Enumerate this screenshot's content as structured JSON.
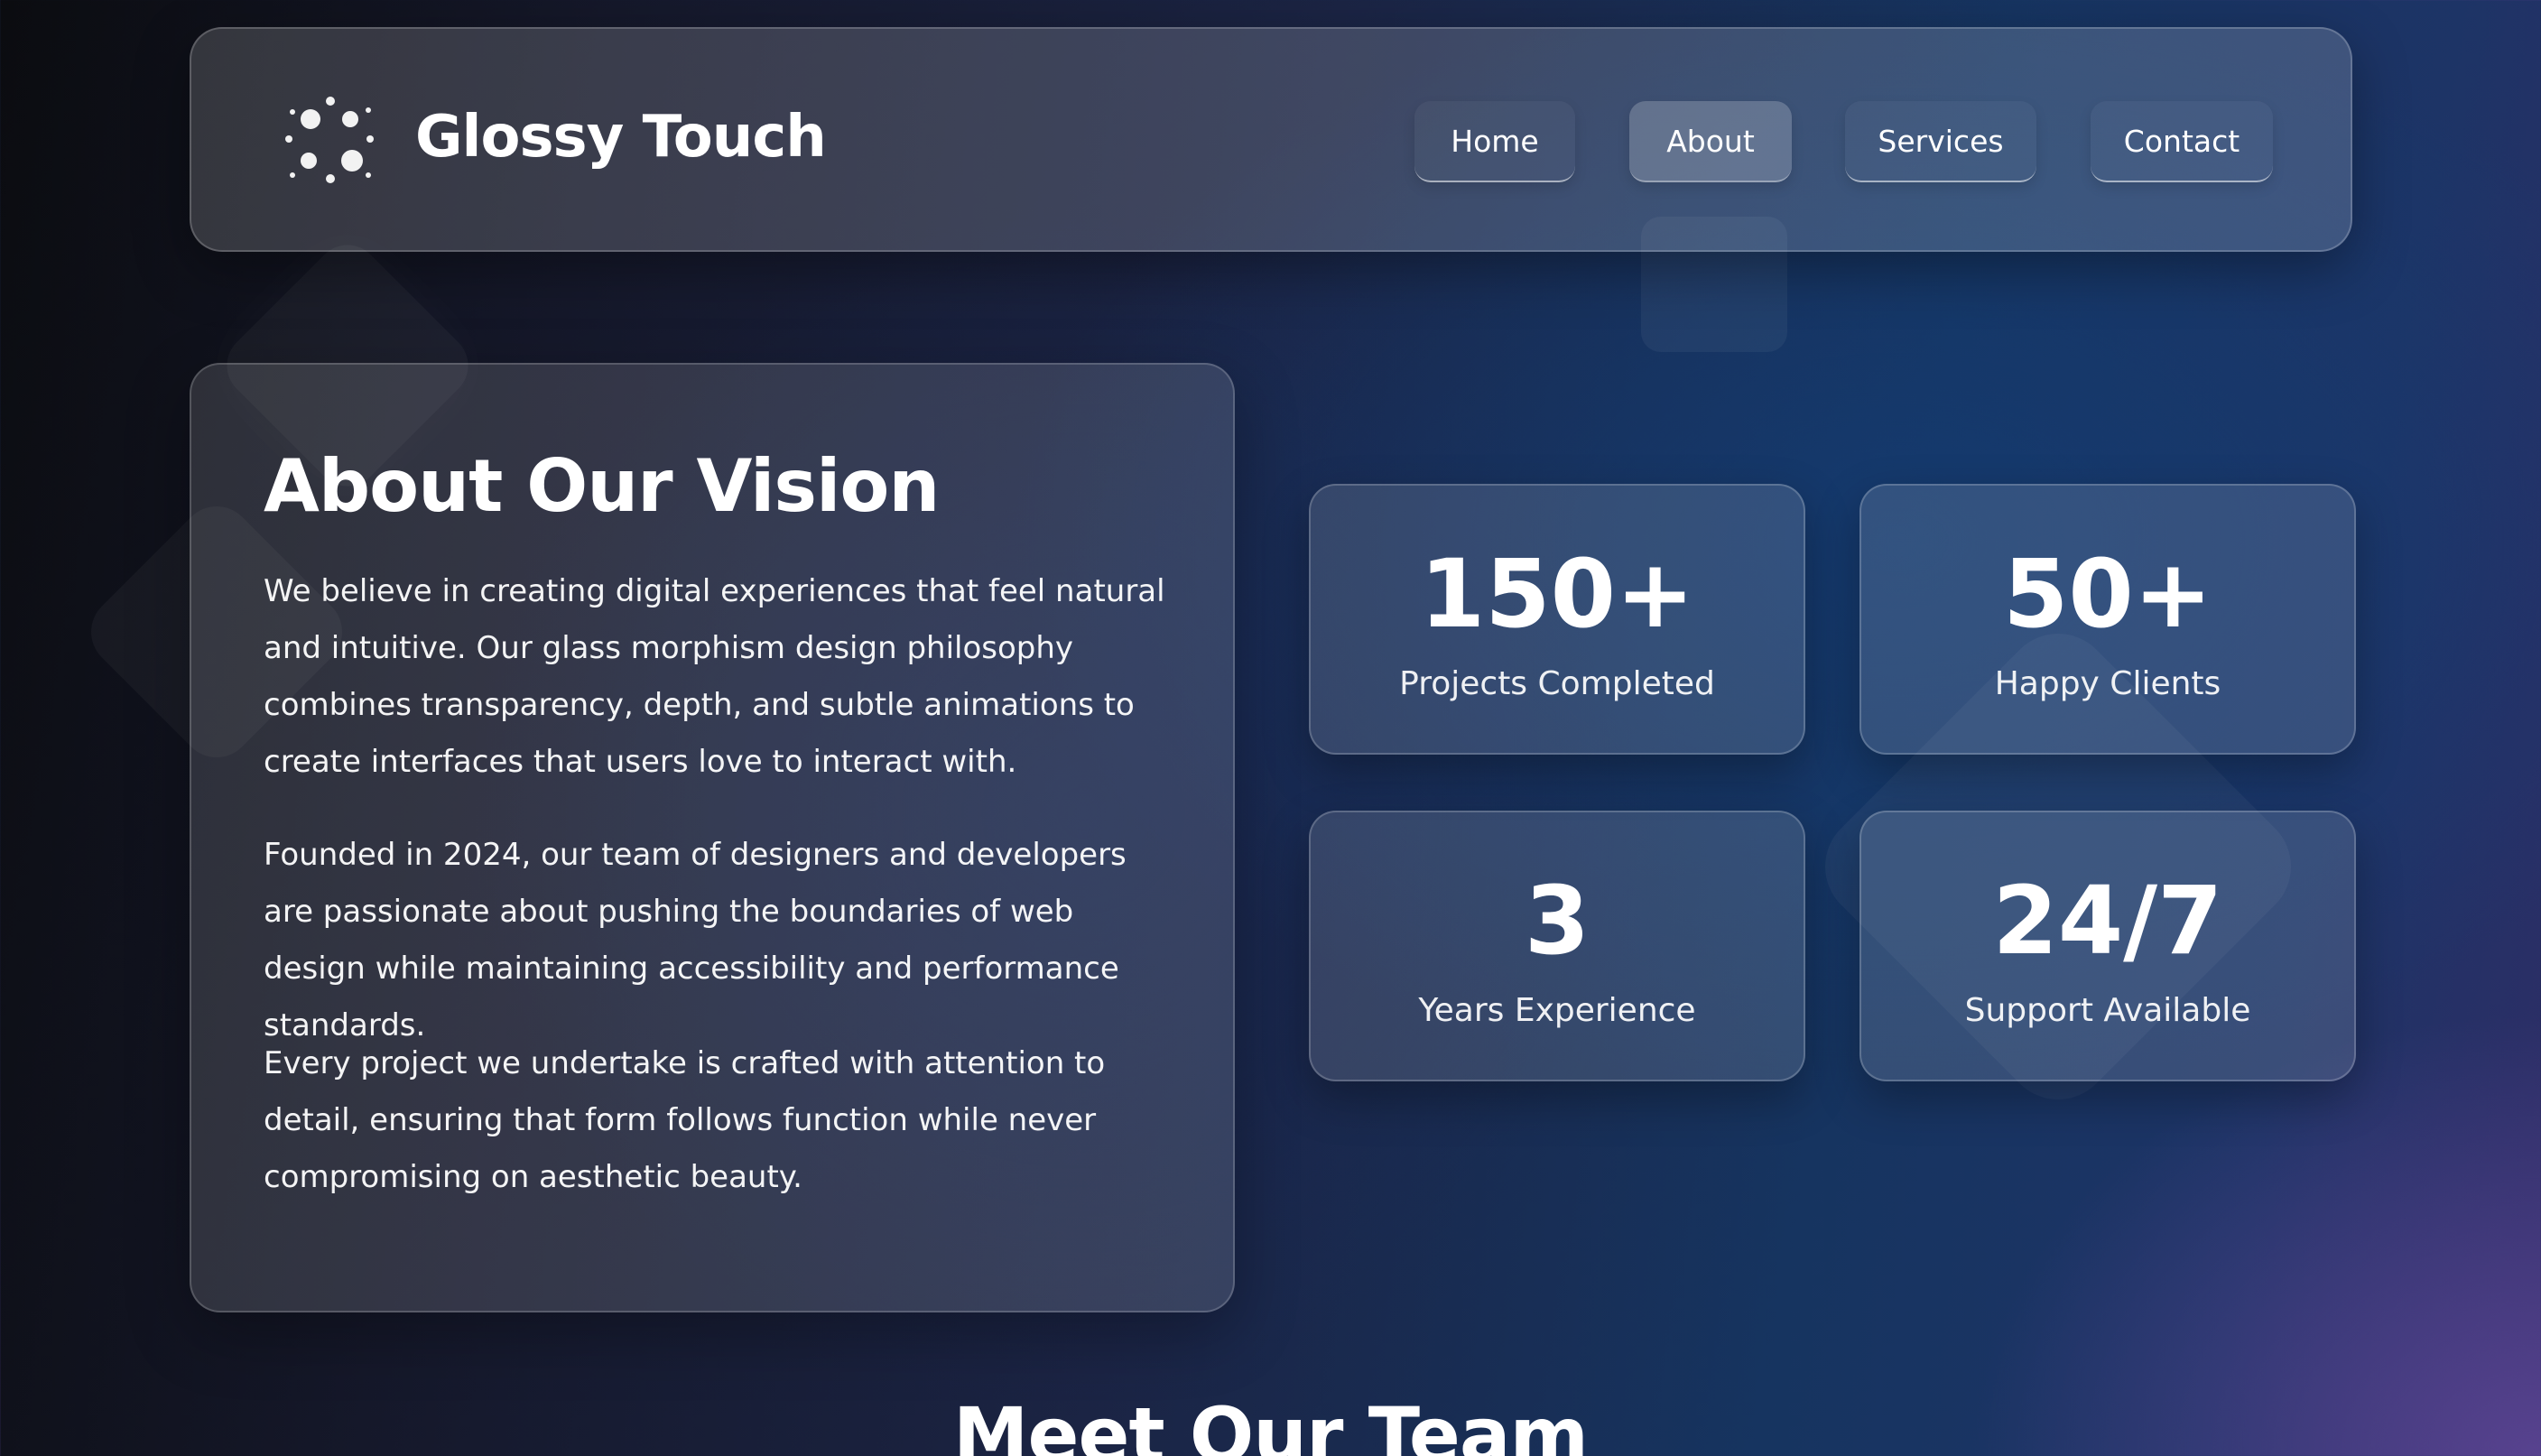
{
  "header": {
    "brand": "Glossy Touch",
    "logo_icon": "sparkle-dots-icon",
    "nav": [
      {
        "label": "Home",
        "active": false
      },
      {
        "label": "About",
        "active": true
      },
      {
        "label": "Services",
        "active": false
      },
      {
        "label": "Contact",
        "active": false
      }
    ]
  },
  "about": {
    "title": "About Our Vision",
    "paragraphs": [
      "We believe in creating digital experiences that feel natural and intuitive. Our glass morphism design philosophy combines transparency, depth, and subtle animations to create interfaces that users love to interact with.",
      "Founded in 2024, our team of designers and developers are passionate about pushing the boundaries of web design while maintaining accessibility and performance standards.",
      "Every project we undertake is crafted with attention to detail, ensuring that form follows function while never compromising on aesthetic beauty."
    ]
  },
  "stats": [
    {
      "value": "150+",
      "label": "Projects Completed"
    },
    {
      "value": "50+",
      "label": "Happy Clients"
    },
    {
      "value": "3",
      "label": "Years Experience"
    },
    {
      "value": "24/7",
      "label": "Support Available"
    }
  ],
  "team": {
    "heading": "Meet Our Team"
  },
  "colors": {
    "text": "#ffffff",
    "background_dark": "#0b0c10",
    "background_blue": "#163460",
    "background_purple": "#5f4696"
  }
}
